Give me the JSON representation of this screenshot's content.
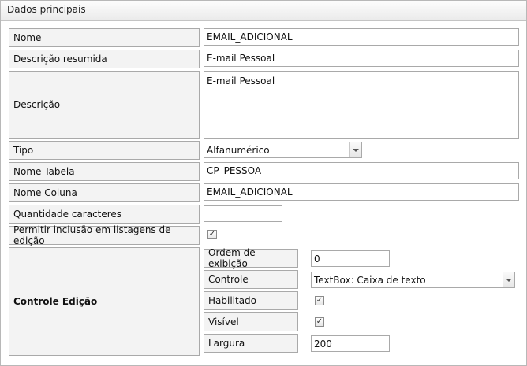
{
  "panel": {
    "title": "Dados principais"
  },
  "fields": {
    "nome": {
      "label": "Nome",
      "value": "EMAIL_ADICIONAL"
    },
    "descricao_resumida": {
      "label": "Descrição resumida",
      "value": "E-mail Pessoal"
    },
    "descricao": {
      "label": "Descrição",
      "value": "E-mail Pessoal"
    },
    "tipo": {
      "label": "Tipo",
      "value": "Alfanumérico"
    },
    "nome_tabela": {
      "label": "Nome Tabela",
      "value": "CP_PESSOA"
    },
    "nome_coluna": {
      "label": "Nome Coluna",
      "value": "EMAIL_ADICIONAL"
    },
    "quantidade": {
      "label": "Quantidade caracteres",
      "value": ""
    },
    "permitir": {
      "label": "Permitir inclusão em listagens de edição",
      "checked": true
    }
  },
  "controle_edicao": {
    "label": "Controle Edição",
    "ordem": {
      "label": "Ordem de exibição",
      "value": "0"
    },
    "controle": {
      "label": "Controle",
      "value": "TextBox: Caixa de texto"
    },
    "habilitado": {
      "label": "Habilitado",
      "checked": true
    },
    "visivel": {
      "label": "Visível",
      "checked": true
    },
    "largura": {
      "label": "Largura",
      "value": "200"
    }
  },
  "icons": {
    "check": "✓",
    "dropdown": "chevron-down-icon"
  }
}
